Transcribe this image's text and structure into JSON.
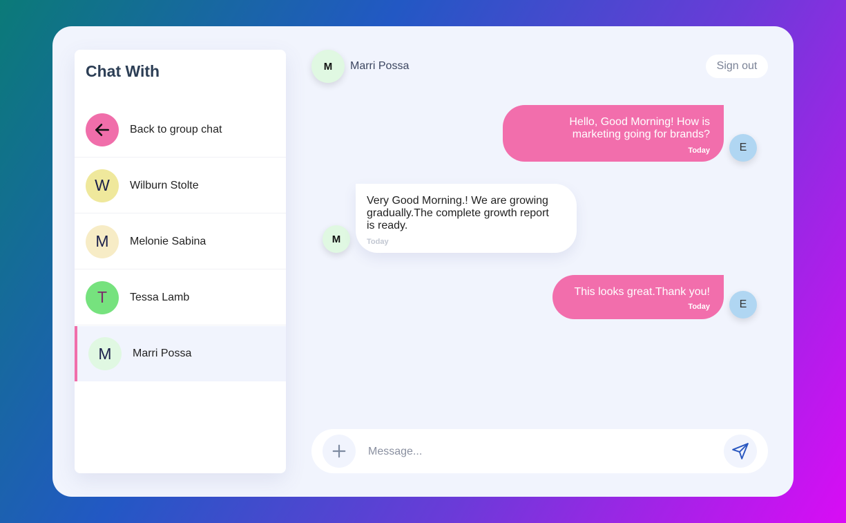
{
  "sidebar": {
    "title": "Chat With",
    "back_label": "Back to group chat",
    "contacts": [
      {
        "initial": "W",
        "name": "Wilburn Stolte",
        "color": "#efe89c",
        "text_color": "#1a1f4a"
      },
      {
        "initial": "M",
        "name": "Melonie Sabina",
        "color": "#f7ecc6",
        "text_color": "#1a1f4a"
      },
      {
        "initial": "T",
        "name": "Tessa Lamb",
        "color": "#76e27e",
        "text_color": "#7b2a6a"
      },
      {
        "initial": "M",
        "name": "Marri Possa",
        "color": "#e0f8e2",
        "text_color": "#1a1f4a",
        "active": true
      }
    ]
  },
  "header": {
    "avatar_initial": "M",
    "name": "Marri Possa",
    "signout_label": "Sign out"
  },
  "messages": [
    {
      "direction": "out",
      "text": "Hello, Good Morning! How is marketing going for brands?",
      "time": "Today",
      "avatar": "E"
    },
    {
      "direction": "in",
      "text": "Very Good Morning.! We are growing gradually.The complete growth report is ready.",
      "time": "Today",
      "avatar": "M"
    },
    {
      "direction": "out",
      "text": "This looks great.Thank you!",
      "time": "Today",
      "avatar": "E"
    }
  ],
  "composer": {
    "placeholder": "Message..."
  },
  "colors": {
    "accent_pink": "#f26eac",
    "card_bg": "#f1f4fd",
    "back_button": "#f06eaa",
    "send_icon": "#2a58c0"
  }
}
